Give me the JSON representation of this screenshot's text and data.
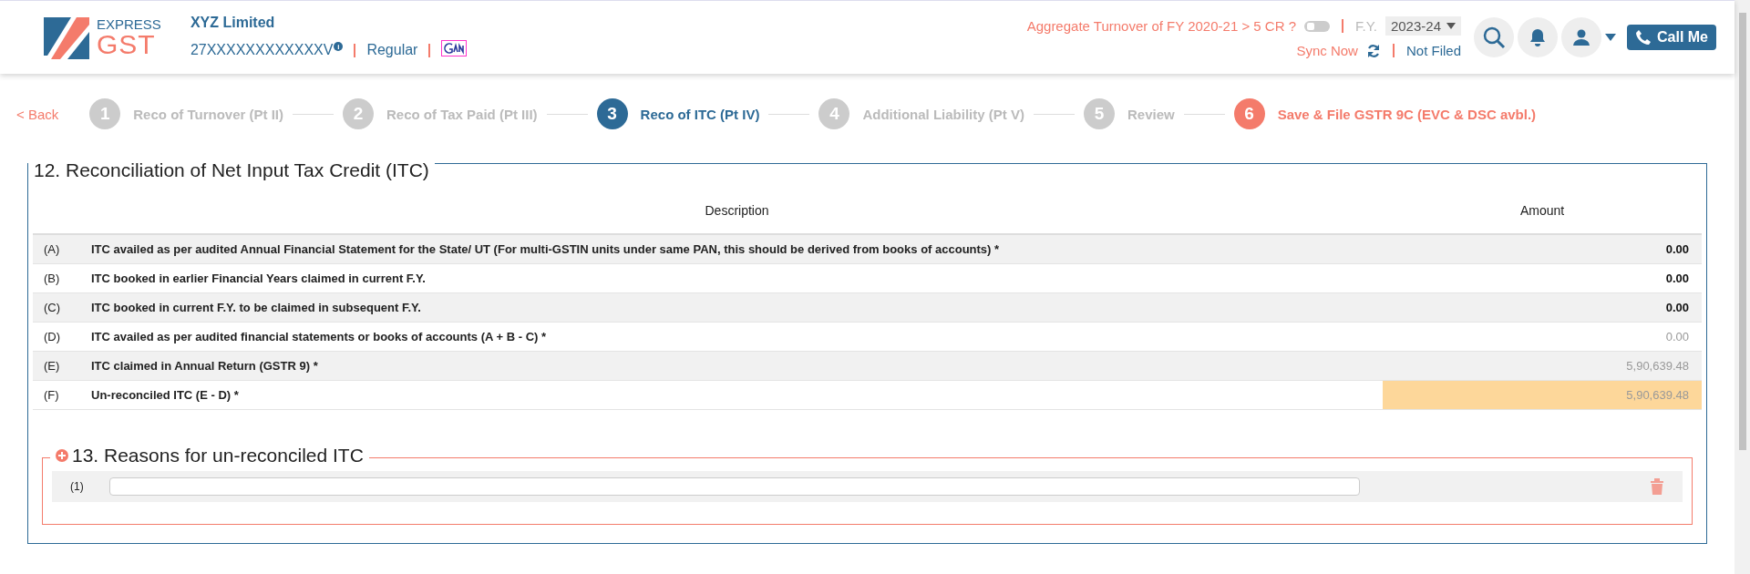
{
  "header": {
    "logo": {
      "top": "EXPRESS",
      "bottom": "GST"
    },
    "company": "XYZ Limited",
    "gstin": "27XXXXXXXXXXXXV",
    "info_icon": "i",
    "registration": "Regular",
    "turnover_question": "Aggregate Turnover of FY 2020-21 > 5 CR ?",
    "turnover_toggle": {
      "on": false
    },
    "fy_label": "F.Y.",
    "fy_value": "2023-24",
    "sync": "Sync Now",
    "filing_status": "Not Filed",
    "call_button": "Call Me"
  },
  "steps": {
    "back": "< Back",
    "items": [
      {
        "number": "1",
        "label": "Reco of Turnover (Pt II)",
        "selected": false,
        "kind": "normal"
      },
      {
        "number": "2",
        "label": "Reco of Tax Paid (Pt III)",
        "selected": false,
        "kind": "normal"
      },
      {
        "number": "3",
        "label": "Reco of ITC (Pt IV)",
        "selected": true,
        "kind": "normal"
      },
      {
        "number": "4",
        "label": "Additional Liability (Pt V)",
        "selected": false,
        "kind": "normal"
      },
      {
        "number": "5",
        "label": "Review",
        "selected": false,
        "kind": "normal"
      },
      {
        "number": "6",
        "label": "Save & File GSTR 9C (EVC & DSC avbl.)",
        "selected": false,
        "kind": "final"
      }
    ]
  },
  "reconciliation": {
    "title": "12. Reconciliation of Net Input Tax Credit (ITC)",
    "columns": [
      "Description",
      "Amount"
    ],
    "rows": [
      {
        "code": "(A)",
        "description": "ITC availed as per audited Annual Financial Statement for the State/ UT (For multi-GSTIN units under same PAN, this should be derived from books of accounts) *",
        "amount": "0.00",
        "kind": "input",
        "highlighted": false
      },
      {
        "code": "(B)",
        "description": "ITC booked in earlier Financial Years claimed in current F.Y.",
        "amount": "0.00",
        "kind": "input",
        "highlighted": false
      },
      {
        "code": "(C)",
        "description": "ITC booked in current F.Y. to be claimed in subsequent F.Y.",
        "amount": "0.00",
        "kind": "input",
        "highlighted": false
      },
      {
        "code": "(D)",
        "description": "ITC availed as per audited financial statements or books of accounts (A + B - C) *",
        "amount": "0.00",
        "kind": "computed",
        "highlighted": false
      },
      {
        "code": "(E)",
        "description": "ITC claimed in Annual Return (GSTR 9) *",
        "amount": "5,90,639.48",
        "kind": "computed",
        "highlighted": false
      },
      {
        "code": "(F)",
        "description": "Un-reconciled ITC (E - D) *",
        "amount": "5,90,639.48",
        "kind": "computed",
        "highlighted": true
      }
    ]
  },
  "reasons": {
    "title": "13. Reasons for un-reconciled ITC",
    "rows": [
      {
        "code": "(1)",
        "value": ""
      }
    ]
  }
}
